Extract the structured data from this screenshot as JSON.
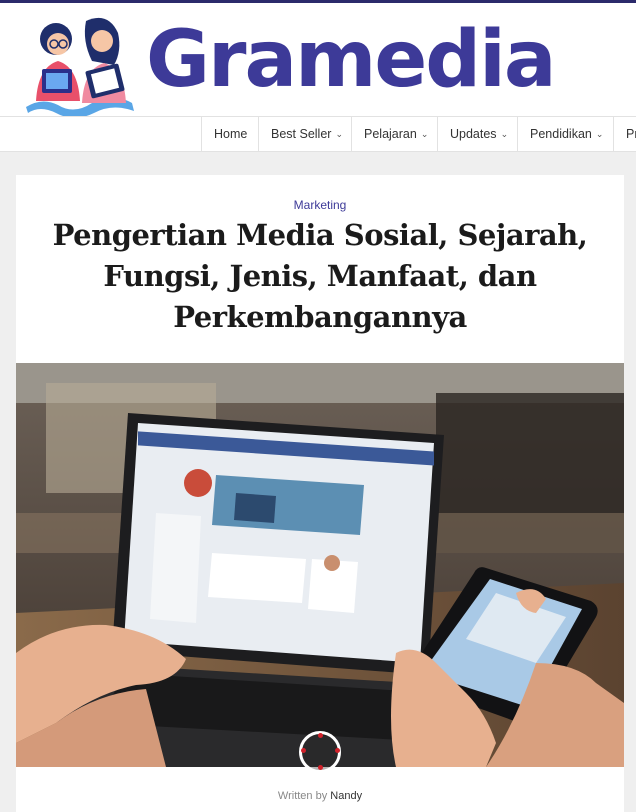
{
  "brand": {
    "logo_text": "Gramedia",
    "logo_color": "#3d3a98",
    "mascot": "reading-kids-logo"
  },
  "nav": {
    "items": [
      {
        "label": "Home",
        "dropdown": false
      },
      {
        "label": "Best Seller",
        "dropdown": true
      },
      {
        "label": "Pelajaran",
        "dropdown": true
      },
      {
        "label": "Updates",
        "dropdown": true
      },
      {
        "label": "Pendidikan",
        "dropdown": true
      },
      {
        "label": "Pr",
        "dropdown": false
      }
    ],
    "chevron_icon": "chevron-down-icon"
  },
  "article": {
    "category": "Marketing",
    "title": "Pengertian Media Sosial, Sejarah, Fungsi, Jenis, Manfaat, dan Perkembangannya",
    "image_subject": "hands on laptop and smartphone showing social media",
    "byline_prefix": "Written by",
    "author": "Nandy"
  },
  "colors": {
    "accent": "#3d3a98",
    "page_bg": "#efefef",
    "loader_dot": "#d0212a"
  }
}
